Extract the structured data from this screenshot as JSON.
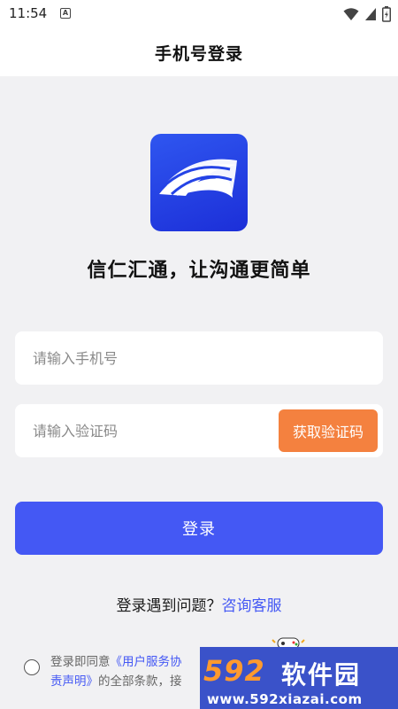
{
  "status_bar": {
    "time": "11:54",
    "notification_letter": "A",
    "icons": [
      "wifi-icon",
      "signal-icon",
      "battery-icon"
    ]
  },
  "header": {
    "title": "手机号登录"
  },
  "app": {
    "slogan": "信仁汇通，让沟通更简单"
  },
  "form": {
    "phone_placeholder": "请输入手机号",
    "phone_value": "",
    "code_placeholder": "请输入验证码",
    "code_value": "",
    "get_code_label": "获取验证码",
    "login_label": "登录"
  },
  "help": {
    "text": "登录遇到问题？",
    "link": "咨询客服"
  },
  "agreement": {
    "prefix": "登录即同意",
    "link1": "《用户服务协",
    "link2": "责声明》",
    "suffix": "的全部条款，接"
  },
  "watermark": {
    "number": "592",
    "title": "软件园",
    "url": "www.592xiazai.com"
  },
  "colors": {
    "primary": "#4458f4",
    "accent_orange": "#f4813f",
    "background": "#f1f1f3",
    "logo_blue": "#1c2fd8"
  }
}
